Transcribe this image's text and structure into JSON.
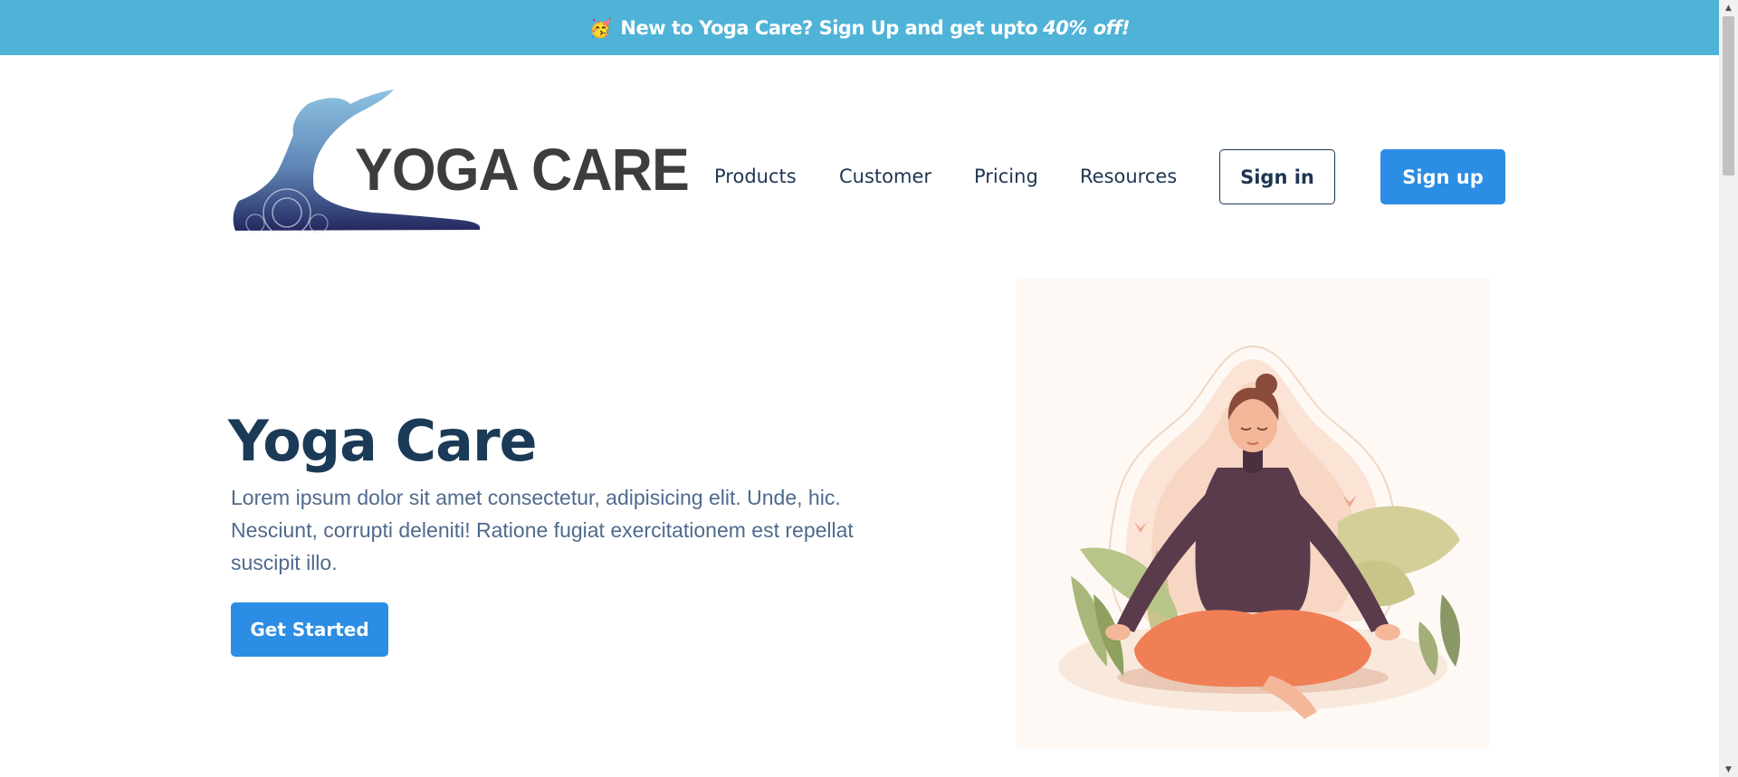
{
  "banner": {
    "emoji": "🥳",
    "text": "New to Yoga Care? Sign Up and get upto",
    "offer": "40% off!"
  },
  "logo": {
    "text": "YOGA CARE"
  },
  "nav": {
    "items": [
      "Products",
      "Customer",
      "Pricing",
      "Resources"
    ],
    "signin_label": "Sign in",
    "signup_label": "Sign up"
  },
  "hero": {
    "title": "Yoga Care",
    "description": "Lorem ipsum dolor sit amet consectetur, adipisicing elit. Unde, hic. Nesciunt, corrupti deleniti! Ratione fugiat exercitationem est repellat suscipit illo.",
    "cta_label": "Get Started"
  },
  "colors": {
    "banner": "#4fb3d7",
    "accent": "#2b8de4",
    "heading": "#1b3a57",
    "body_text": "#4f6a8d"
  },
  "icons": {
    "logo": "yoga-pose-silhouette-icon",
    "illustration": "meditating-woman-illustration"
  }
}
